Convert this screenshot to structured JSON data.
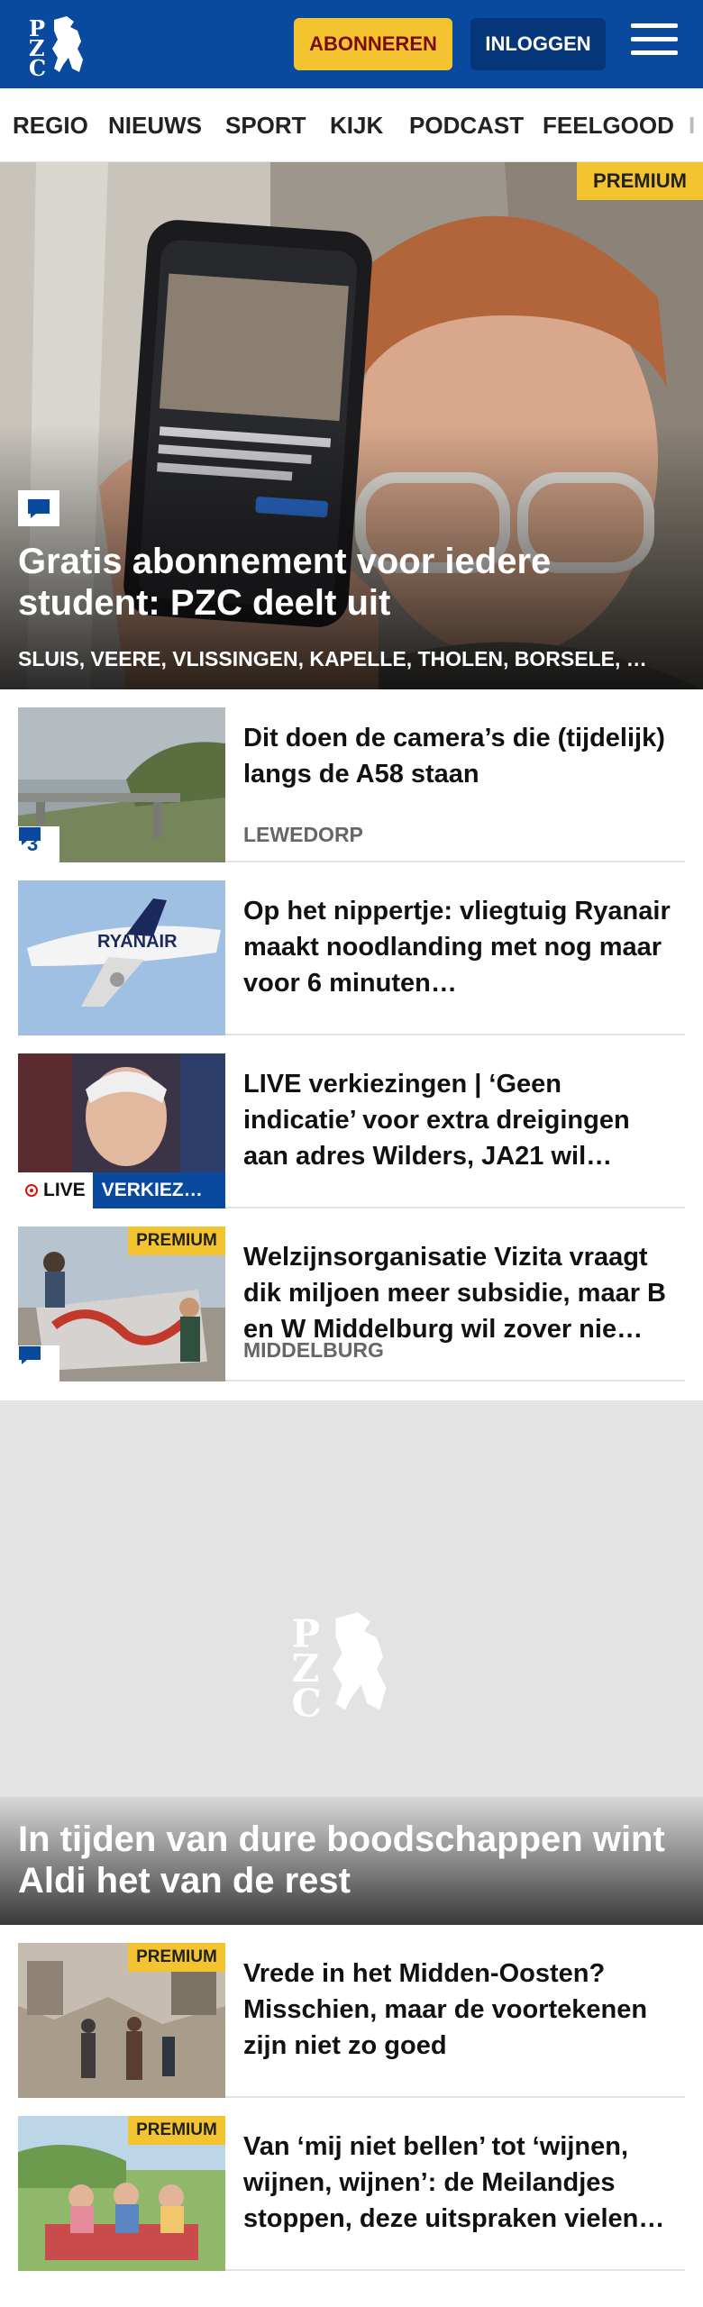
{
  "header": {
    "logo_text": "PZC",
    "subscribe_label": "ABONNEREN",
    "login_label": "INLOGGEN",
    "brand_color": "#0a4a9e",
    "subscribe_color": "#f4c430"
  },
  "nav": {
    "items": [
      {
        "label": "REGIO"
      },
      {
        "label": "NIEUWS"
      },
      {
        "label": "SPORT"
      },
      {
        "label": "KIJK"
      },
      {
        "label": "PODCAST"
      },
      {
        "label": "FEELGOOD"
      }
    ]
  },
  "hero": {
    "badge": "PREMIUM",
    "title": "Gratis abonnement voor iedere student: PZC deelt uit",
    "tags": "SLUIS, VEERE, VLISSINGEN, KAPELLE, THOLEN, BORSELE, …",
    "icon": "comment-icon"
  },
  "articles": [
    {
      "title": "Dit doen de camera’s die (tijdelijk) langs de A58 staan",
      "location": "LEWEDORP",
      "comments": "3"
    },
    {
      "title": "Op het nippertje: vliegtuig Ryanair maakt noodlanding met nog maar voor 6 minuten…",
      "airline_text": "RYANAIR"
    },
    {
      "title": "LIVE verkiezingen | ‘Geen indicatie’ voor extra dreigingen aan adres Wilders, JA21 wil…",
      "live_label": "LIVE",
      "topic_label": "VERKIEZ…"
    },
    {
      "title": "Welzijnsorganisatie Vizita vraagt dik miljoen meer subsidie, maar B en W Middelburg wil zover nie…",
      "location": "MIDDELBURG",
      "badge": "PREMIUM"
    }
  ],
  "feature": {
    "title": "In tijden van dure boodschappen wint Aldi het van de rest"
  },
  "articles2": [
    {
      "title": "Vrede in het Midden-Oosten? Misschien, maar de voortekenen zijn niet zo goed",
      "badge": "PREMIUM"
    },
    {
      "title": "Van ‘mij niet bellen’ tot ‘wijnen, wijnen, wijnen’: de Meilandjes stoppen, deze uitspraken vielen…",
      "badge": "PREMIUM"
    }
  ]
}
